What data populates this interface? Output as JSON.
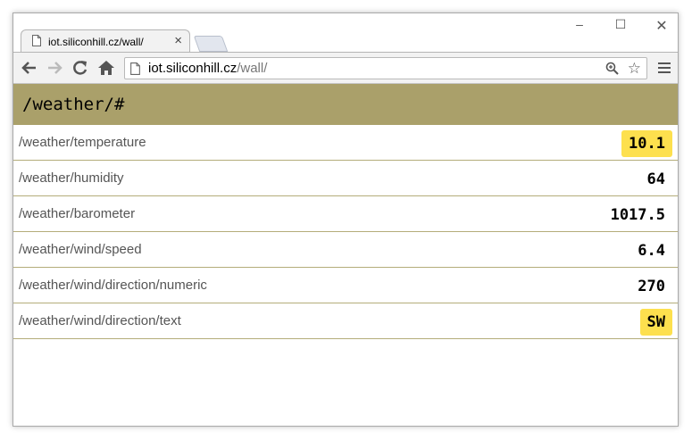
{
  "browser": {
    "tab_title": "iot.siliconhill.cz/wall/",
    "tab_close": "×",
    "url_host": "iot.siliconhill.cz",
    "url_path": "/wall/",
    "win_min": "–",
    "win_max": "☐",
    "win_close": "✕"
  },
  "page": {
    "header": "/weather/#",
    "rows": [
      {
        "key": "/weather/temperature",
        "value": "10.1",
        "highlighted": true
      },
      {
        "key": "/weather/humidity",
        "value": "64",
        "highlighted": false
      },
      {
        "key": "/weather/barometer",
        "value": "1017.5",
        "highlighted": false
      },
      {
        "key": "/weather/wind/speed",
        "value": "6.4",
        "highlighted": false
      },
      {
        "key": "/weather/wind/direction/numeric",
        "value": "270",
        "highlighted": false
      },
      {
        "key": "/weather/wind/direction/text",
        "value": "SW",
        "highlighted": true
      }
    ]
  },
  "colors": {
    "header_bg": "#aaa06a",
    "highlight": "#fde04e",
    "row_border": "#b4ad7a"
  }
}
